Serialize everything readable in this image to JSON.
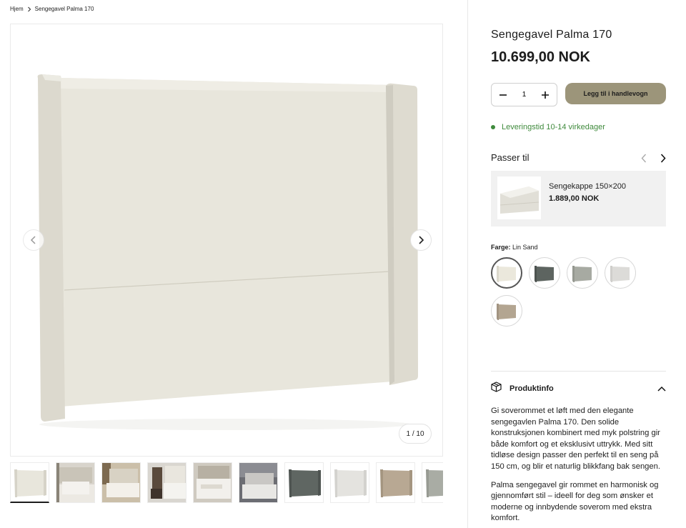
{
  "breadcrumb": {
    "home": "Hjem",
    "current": "Sengegavel Palma 170"
  },
  "gallery": {
    "counter": "1 / 10",
    "thumbnail_count": 10
  },
  "product": {
    "title": "Sengegavel Palma 170",
    "price": "10.699,00 NOK",
    "quantity": "1",
    "add_to_cart": "Legg til i handlevogn",
    "delivery": "Leveringstid 10-14 virkedager",
    "delivery_color": "#3f8a3c",
    "button_color": "#9c957a"
  },
  "fits": {
    "title": "Passer til",
    "items": [
      {
        "name": "Sengekappe 150×200",
        "price": "1.889,00 NOK"
      }
    ]
  },
  "color": {
    "label": "Farge:",
    "selected": "Lin Sand",
    "swatches": [
      {
        "name": "Lin Sand",
        "hex": "#ebe8dc"
      },
      {
        "name": "Grønn",
        "hex": "#5d6460"
      },
      {
        "name": "Grå",
        "hex": "#a7aaa2"
      },
      {
        "name": "Lys grå",
        "hex": "#dcdbd8"
      },
      {
        "name": "Beige",
        "hex": "#b3a591"
      }
    ]
  },
  "info": {
    "heading": "Produktinfo",
    "paragraphs": [
      "Gi soverommet et løft med den elegante sengegavlen Palma 170. Den solide konstruksjonen kombinert med myk polstring gir både komfort og et eksklusivt uttrykk. Med sitt tidløse design passer den perfekt til en seng på 150 cm, og blir et naturlig blikkfang bak sengen.",
      "Palma sengegavel gir rommet en harmonisk og gjennomført stil – ideell for deg som ønsker et moderne og innbydende soverom med ekstra komfort."
    ]
  }
}
